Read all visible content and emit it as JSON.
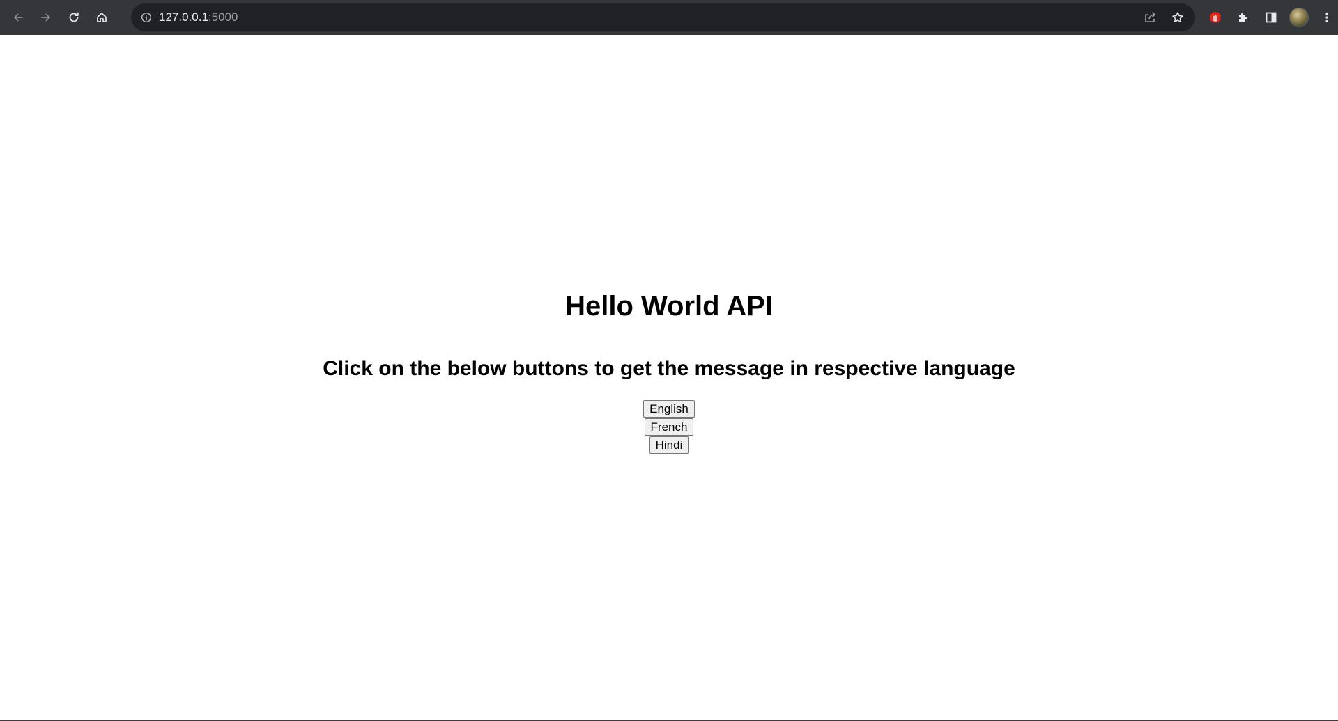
{
  "browser": {
    "url_host": "127.0.0.1",
    "url_port": ":5000",
    "icons": {
      "back": "arrow-left-icon",
      "forward": "arrow-right-icon",
      "reload": "reload-icon",
      "home": "home-icon",
      "site_info": "info-icon",
      "share": "share-icon",
      "bookmark": "star-icon",
      "extension_red": "stop-hand-icon",
      "extensions": "puzzle-icon",
      "side_panel": "side-panel-icon",
      "menu": "more-vert-icon"
    }
  },
  "page": {
    "title": "Hello World API",
    "subtitle": "Click on the below buttons to get the message in respective language",
    "buttons": [
      "English",
      "French",
      "Hindi"
    ]
  },
  "colors": {
    "chrome_bg": "#35363a",
    "omnibox_bg": "#202124",
    "extension_red": "#e1261c"
  }
}
